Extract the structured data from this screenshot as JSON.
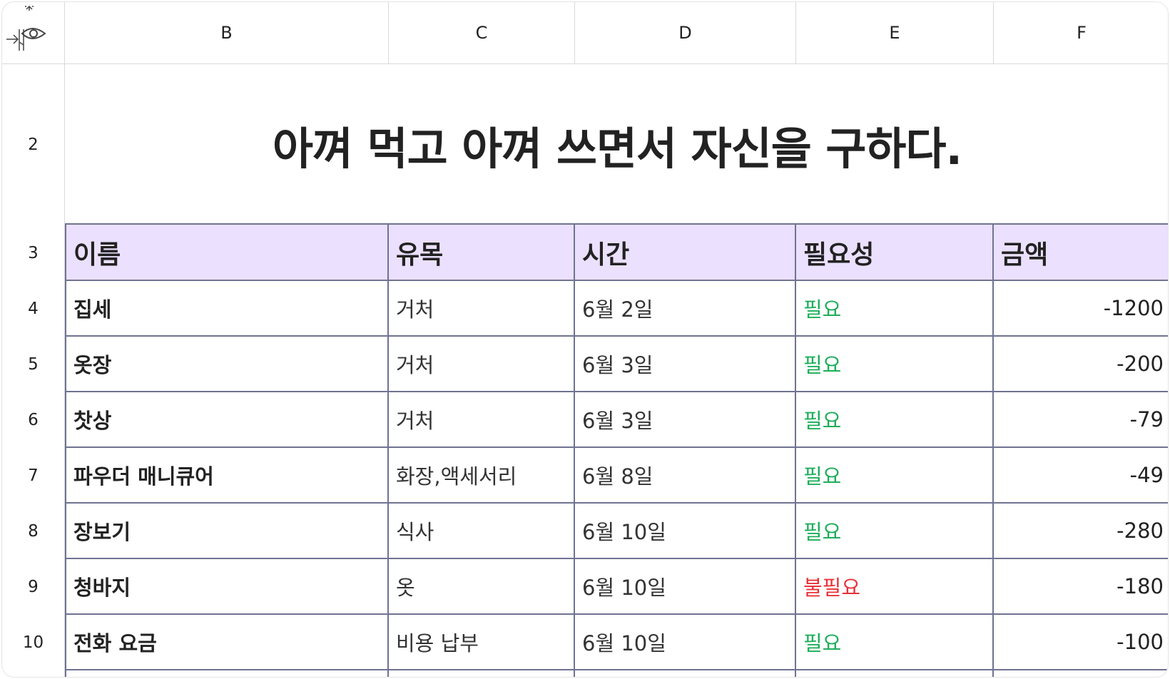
{
  "columns": [
    "B",
    "C",
    "D",
    "E",
    "F"
  ],
  "rows": [
    "2",
    "3",
    "4",
    "5",
    "6",
    "7",
    "8",
    "9",
    "10"
  ],
  "title": "아껴 먹고 아껴 쓰면서 자신을 구하다.",
  "table": {
    "headers": [
      "이름",
      "유목",
      "시간",
      "필요성",
      "금액"
    ],
    "records": [
      {
        "name": "집세",
        "category": "거처",
        "date": "6월 2일",
        "necessity": "필요",
        "amount": "-1200"
      },
      {
        "name": "옷장",
        "category": "거처",
        "date": "6월 3일",
        "necessity": "필요",
        "amount": "-200"
      },
      {
        "name": "찻상",
        "category": "거처",
        "date": "6월 3일",
        "necessity": "필요",
        "amount": "-79"
      },
      {
        "name": "파우더 매니큐어",
        "category": "화장,액세서리",
        "date": "6월 8일",
        "necessity": "필요",
        "amount": "-49"
      },
      {
        "name": "장보기",
        "category": "식사",
        "date": "6월 10일",
        "necessity": "필요",
        "amount": "-280"
      },
      {
        "name": "청바지",
        "category": "옷",
        "date": "6월 10일",
        "necessity": "불필요",
        "amount": "-180"
      },
      {
        "name": "전화 요금",
        "category": "비용 납부",
        "date": "6월 10일",
        "necessity": "필요",
        "amount": "-100"
      }
    ]
  },
  "colors": {
    "header_fill": "#ebe0fe",
    "grid_line": "#6f7391",
    "needed": "#1fae5b",
    "not_needed": "#e8333b"
  },
  "icons": [
    "expand-columns-icon",
    "eye-icon"
  ]
}
